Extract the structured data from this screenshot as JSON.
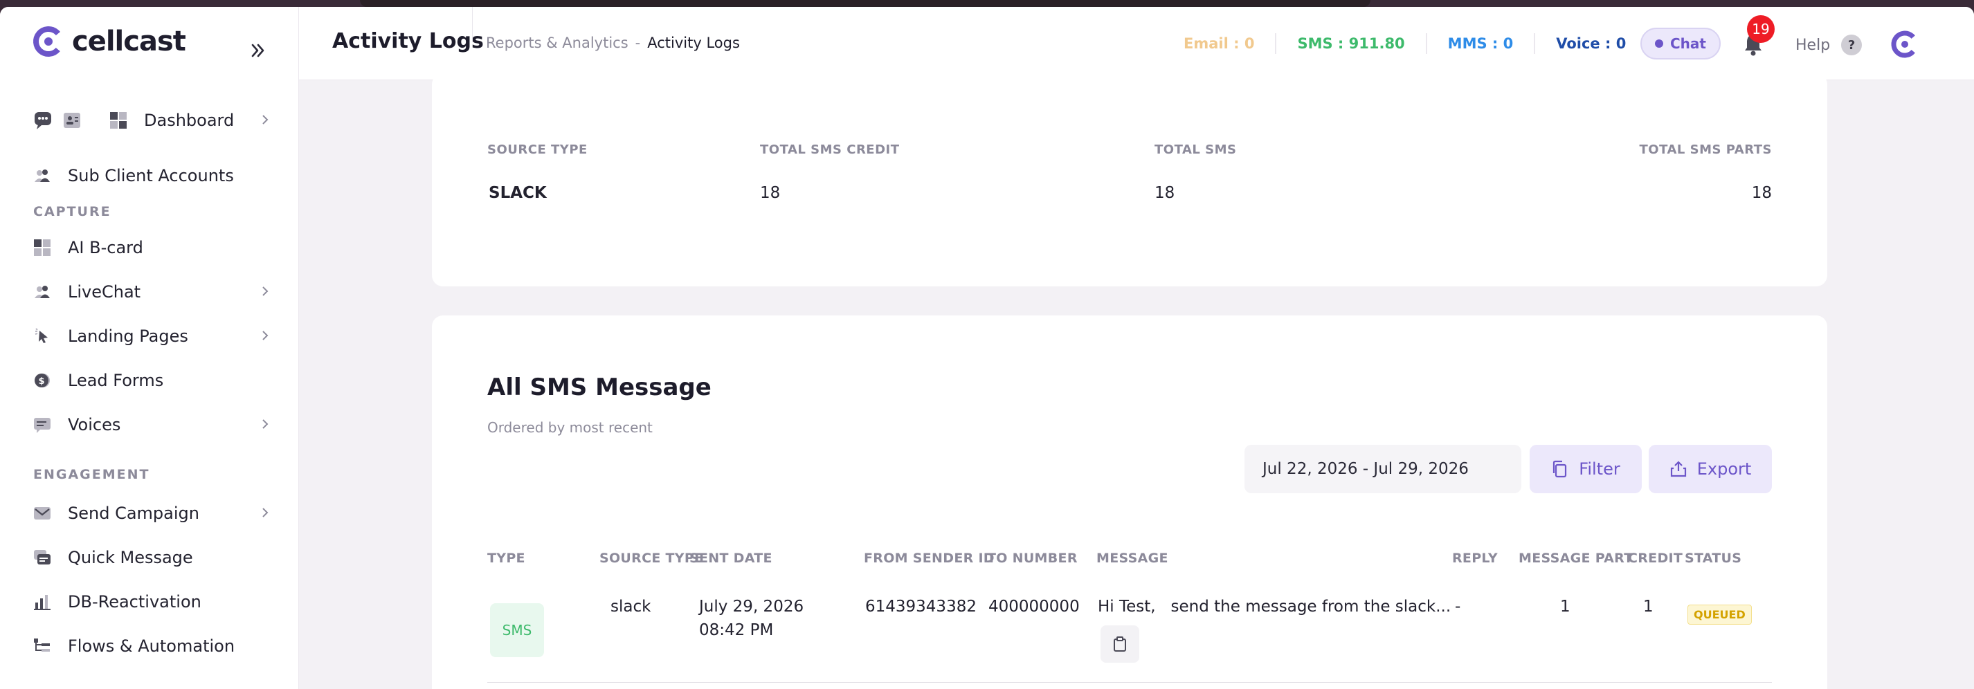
{
  "app": {
    "logo_text": "cellcast",
    "brand_color": "#6c55c9"
  },
  "sidebar": {
    "dashboard": "Dashboard",
    "sub_client": "Sub Client Accounts",
    "section_capture": "CAPTURE",
    "ai_bcard": "AI B-card",
    "livechat": "LiveChat",
    "landing_pages": "Landing Pages",
    "lead_forms": "Lead Forms",
    "voices": "Voices",
    "section_engagement": "ENGAGEMENT",
    "send_campaign": "Send Campaign",
    "quick_message": "Quick Message",
    "db_reactivation": "DB-Reactivation",
    "flows": "Flows & Automation"
  },
  "header": {
    "title": "Activity Logs",
    "breadcrumb_parent": "Reports & Analytics",
    "breadcrumb_sep": "-",
    "breadcrumb_current": "Activity Logs",
    "email_label": "Email :",
    "email_value": "0",
    "sms_label": "SMS :",
    "sms_value": "911.80",
    "mms_label": "MMS :",
    "mms_value": "0",
    "voice_label": "Voice :",
    "voice_value": "0",
    "chat_label": "Chat",
    "notification_count": "19",
    "help_label": "Help",
    "help_icon_text": "?"
  },
  "summary": {
    "headers": [
      "SOURCE TYPE",
      "TOTAL SMS CREDIT",
      "TOTAL SMS",
      "TOTAL SMS PARTS"
    ],
    "row": [
      "SLACK",
      "18",
      "18",
      "18"
    ]
  },
  "messages": {
    "title": "All SMS Message",
    "subtitle": "Ordered by most recent",
    "date_range": "Jul 22, 2026 - Jul 29, 2026",
    "filter_label": "Filter",
    "export_label": "Export",
    "columns": [
      "TYPE",
      "SOURCE TYPE",
      "SENT DATE",
      "FROM SENDER ID",
      "TO NUMBER",
      "MESSAGE",
      "REPLY",
      "MESSAGE PART",
      "CREDIT",
      "STATUS"
    ],
    "rows": [
      {
        "type": "SMS",
        "source_type": "slack",
        "sent_date": "July 29, 2026",
        "sent_time": "08:42 PM",
        "from_sender": "61439343382",
        "to_number": "400000000",
        "message": "Hi Test,   send the message from the slack...",
        "reply": "-",
        "message_part": "1",
        "credit": "1",
        "status": "QUEUED"
      }
    ]
  }
}
